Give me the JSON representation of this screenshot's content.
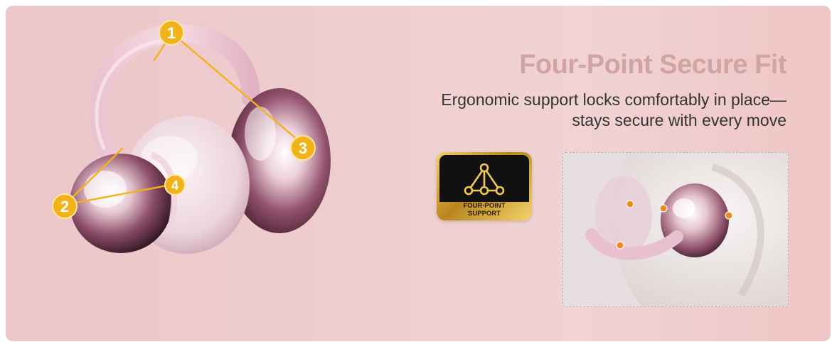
{
  "heading": "Four-Point Secure Fit",
  "subtext": {
    "line1": "Ergonomic support locks comfortably in place—",
    "line2": "stays secure with every move"
  },
  "markers": [
    "1",
    "2",
    "3",
    "4"
  ],
  "badge": {
    "line1": "FOUR-POINT",
    "line2": "SUPPORT"
  },
  "colors": {
    "marker": "#f2b31a",
    "heading": "#d2a3a3",
    "text": "#333333",
    "photo_dot": "#f08a1e"
  }
}
